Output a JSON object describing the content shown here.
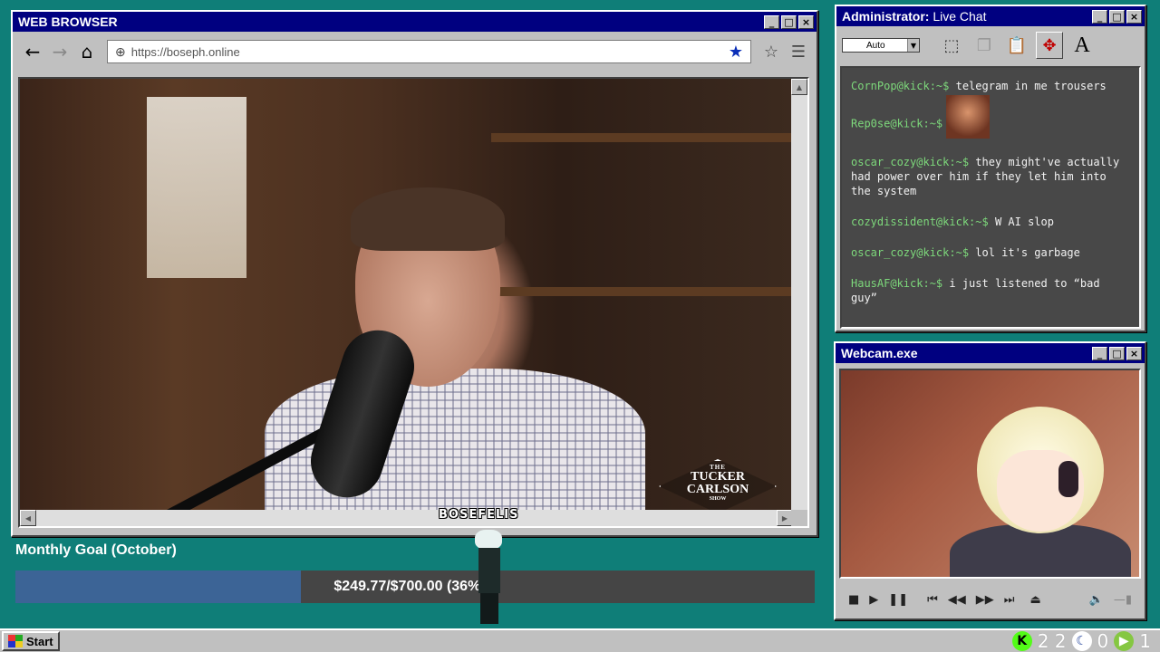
{
  "browser": {
    "title": "WEB BROWSER",
    "url": "https://boseph.online",
    "nav": {
      "back": "🡐",
      "forward": "🡒",
      "home": "⌂"
    },
    "video": {
      "logo": {
        "line1": "THE",
        "line2": "TUCKER",
        "line3": "CARLSON",
        "line4": "SHOW"
      }
    }
  },
  "chat": {
    "title_bold": "Administrator:",
    "title_rest": " Live Chat",
    "font_size_select": "Auto",
    "messages": [
      {
        "user": "CornPop@kick:~$",
        "text": " telegram in me trousers"
      },
      {
        "user": "Rep0se@kick:~$",
        "text": "",
        "emote": true
      },
      {
        "user": "oscar_cozy@kick:~$",
        "text": " they might've actually had power over him if they let him into the system"
      },
      {
        "user": "cozydissident@kick:~$",
        "text": " W AI slop"
      },
      {
        "user": "oscar_cozy@kick:~$",
        "text": " lol it's garbage"
      },
      {
        "user": "HausAF@kick:~$",
        "text": " i just listened to “bad guy”"
      }
    ]
  },
  "webcam": {
    "title": "Webcam.exe"
  },
  "goal": {
    "title": "Monthly Goal (October)",
    "label": "$249.77/$700.00 (36%)",
    "current": 249.77,
    "target": 700.0,
    "percent": 36
  },
  "sprite": {
    "label": "BOSEFELIS"
  },
  "taskbar": {
    "start_label": "Start",
    "kick_count": "2 2",
    "moon_count": "0",
    "rumble_count": "1"
  },
  "colors": {
    "desktop": "#0f7e78",
    "titlebar": "#000080",
    "chat_user": "#7dd87b",
    "goal_fill": "#3c6496"
  }
}
